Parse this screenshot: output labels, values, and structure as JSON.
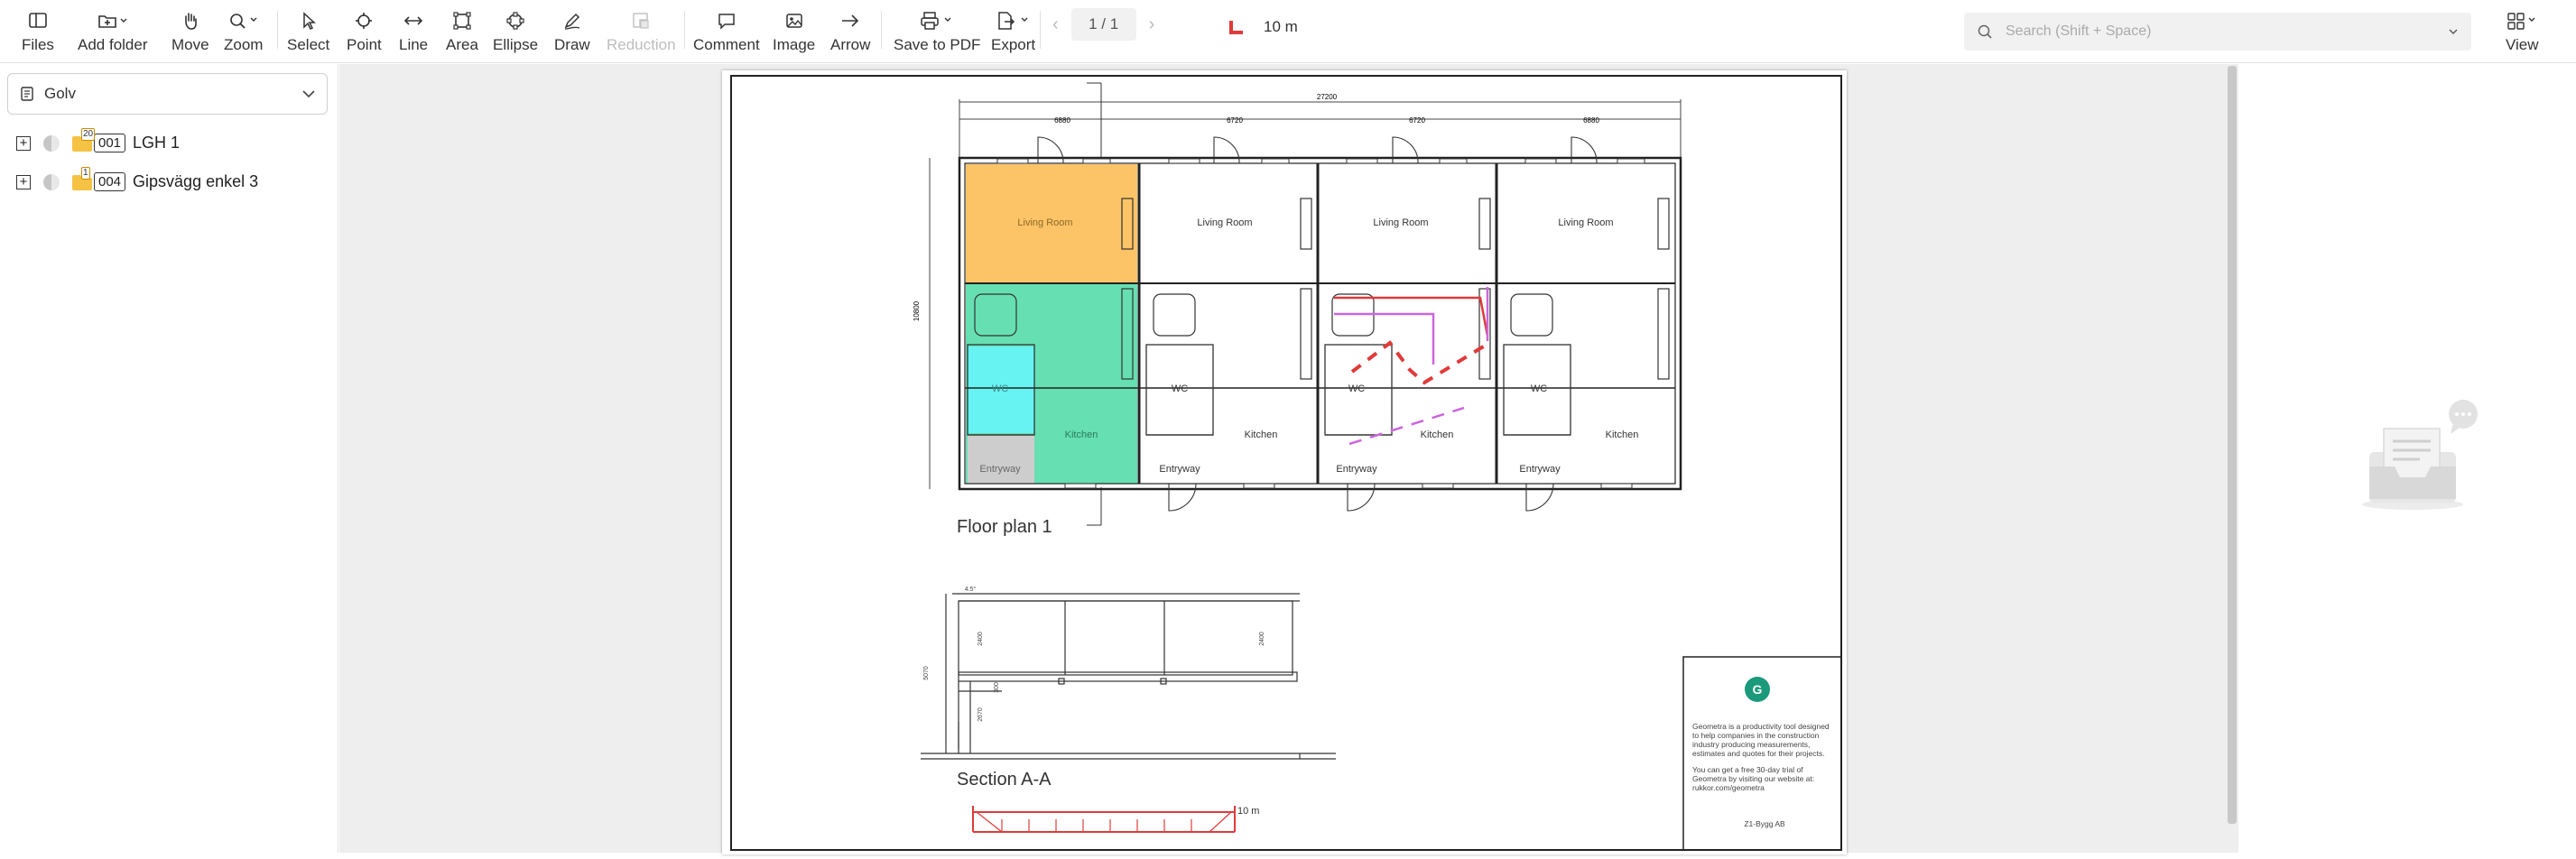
{
  "toolbar": {
    "files": "Files",
    "add_folder": "Add folder",
    "move": "Move",
    "zoom": "Zoom",
    "select": "Select",
    "point": "Point",
    "line": "Line",
    "area": "Area",
    "ellipse": "Ellipse",
    "draw": "Draw",
    "reduction": "Reduction",
    "comment": "Comment",
    "image": "Image",
    "arrow": "Arrow",
    "save_pdf": "Save to PDF",
    "export": "Export",
    "view": "View"
  },
  "pager": {
    "current": "1 / 1"
  },
  "scale": {
    "value": "10 m"
  },
  "search": {
    "placeholder": "Search (Shift + Space)"
  },
  "sidebar": {
    "layer_select": "Golv",
    "folders": [
      {
        "count": "20",
        "code": "001",
        "name": "LGH 1"
      },
      {
        "count": "1",
        "code": "004",
        "name": "Gipsvägg enkel 3"
      }
    ]
  },
  "drawing": {
    "overall_dim": "27200",
    "bay_dims": [
      "6880",
      "6720",
      "6720",
      "6880"
    ],
    "height_dim": "10800",
    "rooms": {
      "living": "Living Room",
      "wc": "WC",
      "kitchen": "Kitchen",
      "entryway": "Entryway"
    },
    "floor_plan_title": "Floor plan 1",
    "section_title": "Section A-A",
    "section_dims": [
      "4.5°",
      "2400",
      "2400",
      "5070",
      "300",
      "2670"
    ],
    "scalebar_label": "10 m",
    "titleblock": {
      "logo_letter": "G",
      "text_1": "Geometra is a productivity tool designed to help companies in the construction industry producing measurements, estimates and quotes for their projects.",
      "text_2": "You can get a free 30-day trial of Geometra by visiting our website at: rukkor.com/geometra",
      "footer": "Z1-Bygg AB"
    }
  },
  "colors": {
    "living_fill": "#fcc466",
    "green_fill": "#66dfb3",
    "wc_fill": "#66f3f2",
    "entry_fill": "#cdcdcd",
    "red_measure": "#e03a3a",
    "magenta_measure": "#cc66dd",
    "logo_green": "#1a9a7a"
  }
}
